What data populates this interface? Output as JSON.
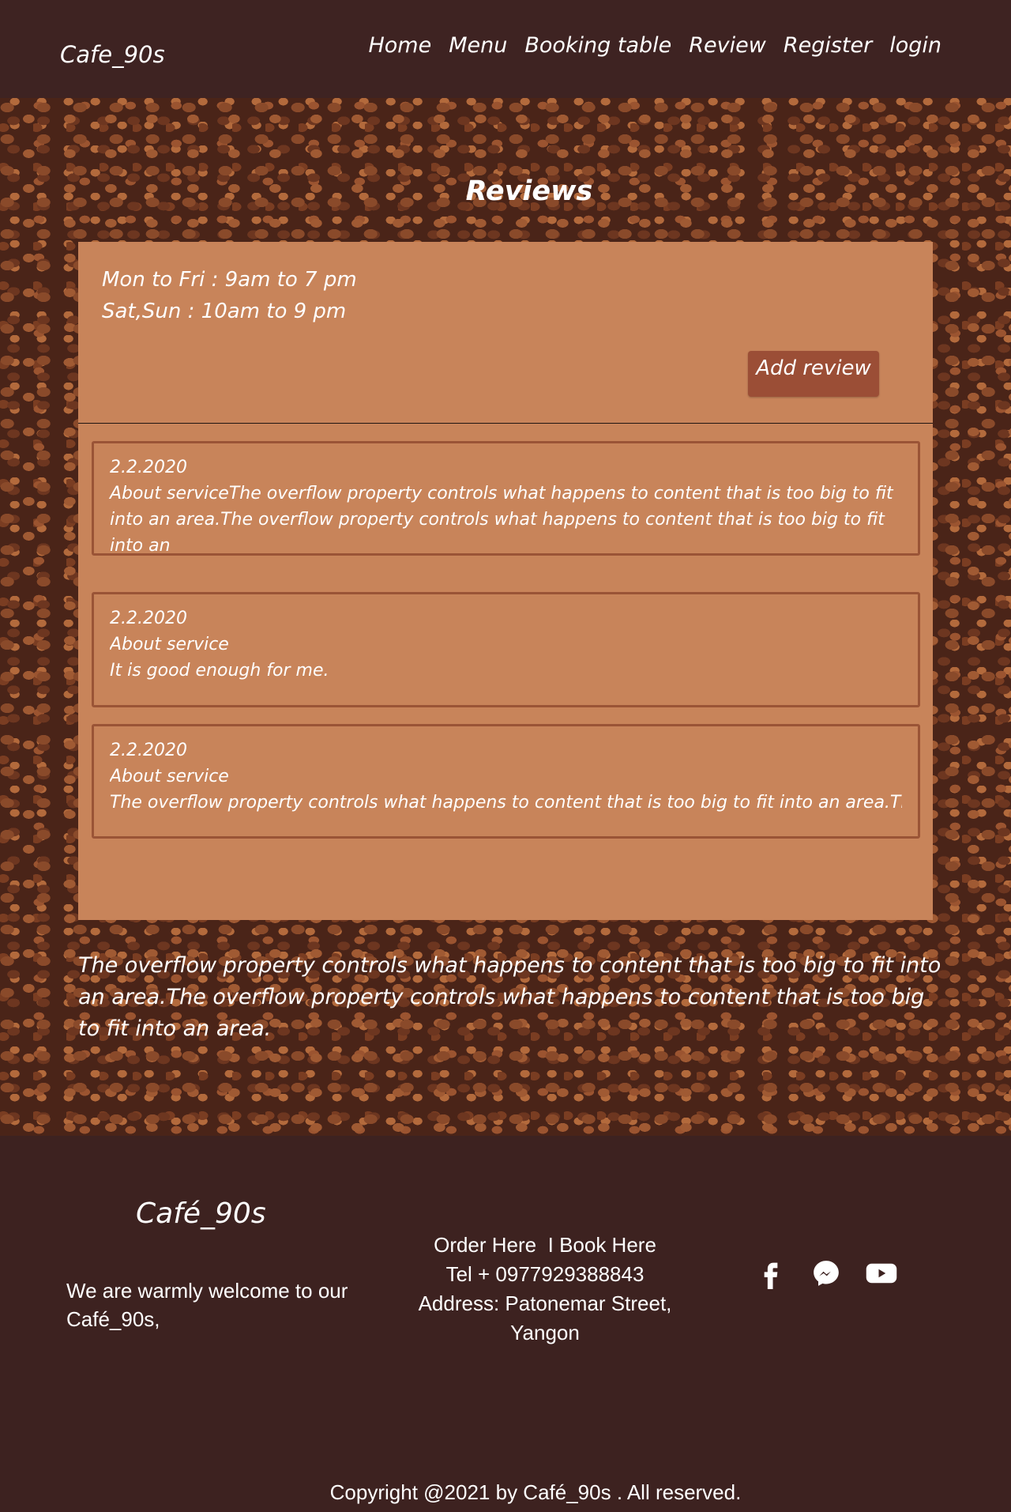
{
  "nav": {
    "brand": "Cafe_90s",
    "links": [
      "Home",
      "Menu",
      "Booking table",
      "Review",
      "Register",
      "login"
    ]
  },
  "reviews_section": {
    "heading": "Reviews",
    "hours": [
      "Mon to Fri : 9am to 7 pm",
      "Sat,Sun : 10am to 9 pm"
    ],
    "add_review_label": "Add review",
    "items": [
      {
        "date": "2.2.2020",
        "text": "About serviceThe overflow property controls what happens to content that is too big to fit into an area.The overflow property controls what happens to content that is too big to fit into an"
      },
      {
        "date": "2.2.2020",
        "topic": "About service",
        "text": "It is good enough for me."
      },
      {
        "date": "2.2.2020",
        "topic": "About service",
        "text": "The overflow property controls what happens to content that is too big to fit into an area.The"
      }
    ],
    "note": "The overflow property controls what happens to content that is too big to fit into an area.The overflow property controls what happens to content that is too big to fit into an area."
  },
  "footer": {
    "brand": "Café_90s",
    "welcome": "We are warmly welcome to our Café_90s,",
    "order_link": "Order Here",
    "separator": "I",
    "book_link": "Book Here",
    "tel": "Tel + 0977929388843",
    "address": "Address: Patonemar Street, Yangon",
    "social_icons": [
      "facebook-icon",
      "messenger-icon",
      "youtube-icon"
    ],
    "copyright": "Copyright @2021 by Café_90s . All reserved."
  },
  "colors": {
    "nav_bg": "#3e2322",
    "card_bg": "#c8845a",
    "button_bg": "#9b4e36",
    "review_border": "#9a5436",
    "footer_bg": "#3d2220"
  }
}
